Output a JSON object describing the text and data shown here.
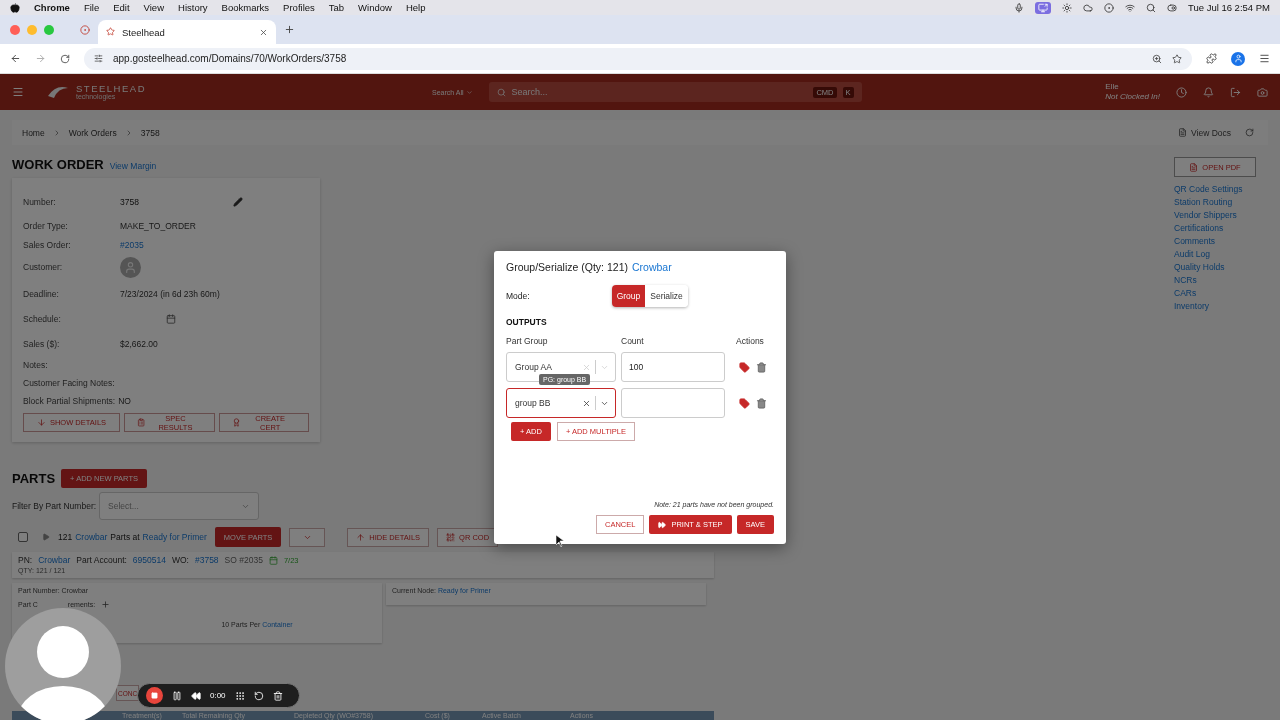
{
  "menubar": {
    "app": "Chrome",
    "menus": [
      "File",
      "Edit",
      "View",
      "History",
      "Bookmarks",
      "Profiles",
      "Tab",
      "Window",
      "Help"
    ],
    "clock": "Tue Jul 16  2:54 PM"
  },
  "browser": {
    "tabs": [
      {
        "title": "Steelhead",
        "selected": true
      }
    ],
    "url": "app.gosteelhead.com/Domains/70/WorkOrders/3758"
  },
  "header": {
    "logo_name": "STEELHEAD",
    "logo_sub": "technologies",
    "search_scope": "Search All",
    "search_placeholder": "Search...",
    "shortcut_keys": [
      "CMD",
      "K"
    ],
    "user": "Elle",
    "user_status": "Not Clocked In!"
  },
  "breadcrumbs": [
    "Home",
    "Work Orders",
    "3758"
  ],
  "view_docs": "View Docs",
  "work_order": {
    "title": "WORK ORDER",
    "view_margin": "View Margin",
    "fields": [
      {
        "label": "Number:",
        "value": "3758",
        "kind": "editable"
      },
      {
        "label": "Order Type:",
        "value": "MAKE_TO_ORDER",
        "kind": "text"
      },
      {
        "label": "Sales Order:",
        "value": "#2035",
        "kind": "link"
      },
      {
        "label": "Customer:",
        "kind": "avatar"
      },
      {
        "label": "Deadline:",
        "value": "7/23/2024 (in 6d 23h 60m)",
        "kind": "text"
      },
      {
        "label": "Schedule:",
        "kind": "calendar"
      },
      {
        "label": "Sales ($):",
        "value": "$2,662.00",
        "kind": "text"
      },
      {
        "label": "Notes:",
        "kind": "text"
      },
      {
        "label": "Customer Facing Notes:",
        "kind": "text"
      },
      {
        "label": "Block Partial Shipments:",
        "value": "NO",
        "kind": "inline"
      }
    ],
    "buttons": [
      {
        "label": "SHOW DETAILS",
        "kind": "arrow"
      },
      {
        "label": "SPEC RESULTS",
        "kind": "clipboard"
      },
      {
        "label": "CREATE CERT",
        "kind": "award"
      }
    ]
  },
  "sidebar": {
    "open_pdf": "OPEN PDF",
    "links": [
      "QR Code Settings",
      "Station Routing",
      "Vendor Shippers",
      "Certifications",
      "Comments",
      "Audit Log",
      "Quality Holds",
      "NCRs",
      "CARs",
      "Inventory"
    ]
  },
  "parts": {
    "title": "PARTS",
    "add_button": "+ ADD NEW PARTS",
    "filter_label": "Filter By Part Number:",
    "filter_placeholder": "Select...",
    "group": {
      "checked": false,
      "count": "121",
      "part": "Crowbar",
      "middle": "Parts at",
      "node": "Ready for Primer",
      "move": "MOVE PARTS",
      "hide": "HIDE DETAILS",
      "qr": "QR COD"
    },
    "detail": {
      "pn_label": "PN:",
      "pn": "Crowbar",
      "account_label": "Part Account:",
      "account": "6950514",
      "wo_label": "WO:",
      "wo": "#3758",
      "so": "SO #2035",
      "date": "7/23",
      "qty": "QTY: 121 / 121"
    },
    "part_number": "Part Number: Crowbar",
    "requirements": [
      "Part C",
      "rements:"
    ],
    "per_container": "10 Parts Per",
    "container": "Container",
    "node_label": "Current Node:",
    "node": "Ready for Primer",
    "partial_button": "CONC",
    "columns": [
      "Treatment(s)",
      "Total Remaining Qty",
      "Depleted Qty (WO#3758)",
      "Cost ($)",
      "Active Batch",
      "Actions"
    ]
  },
  "modal": {
    "title": "Group/Serialize (Qty: 121)",
    "title_link": "Crowbar",
    "mode_label": "Mode:",
    "modes": [
      {
        "label": "Group",
        "selected": true
      },
      {
        "label": "Serialize",
        "selected": false
      }
    ],
    "outputs_title": "OUTPUTS",
    "columns": [
      "Part Group",
      "Count",
      "Actions"
    ],
    "rows": [
      {
        "group": "Group AA",
        "count": "100",
        "focused": false
      },
      {
        "group": "group BB",
        "focused": true
      }
    ],
    "tooltip": "PG: group BB",
    "add": "+ ADD",
    "add_multiple": "+ ADD MULTIPLE",
    "note": "Note: 21 parts have not been grouped.",
    "cancel": "CANCEL",
    "print_step": "PRINT & STEP",
    "save": "SAVE"
  },
  "recorder": {
    "time": "0:00"
  }
}
